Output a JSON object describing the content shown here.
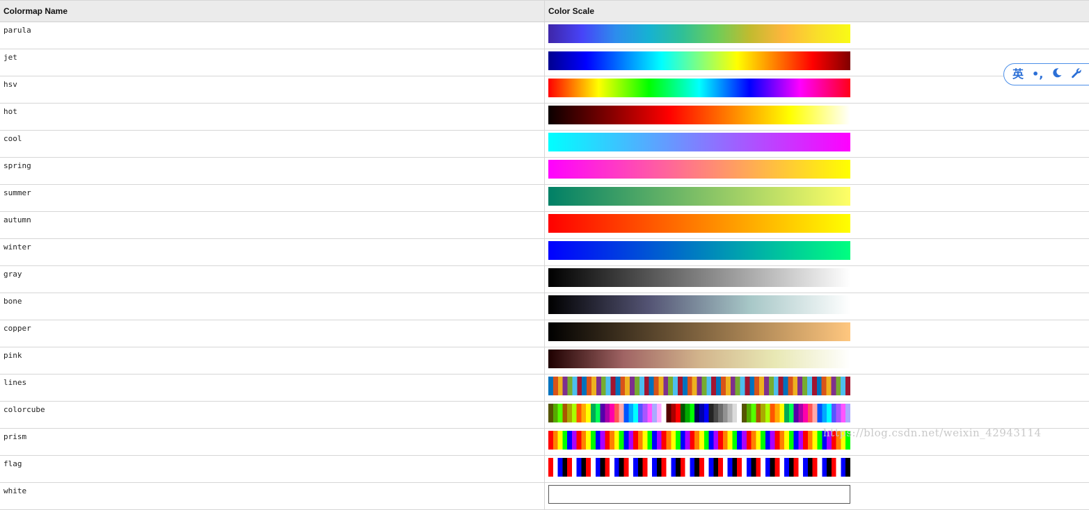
{
  "table": {
    "header": {
      "name_col": "Colormap Name",
      "scale_col": "Color Scale"
    },
    "rows": [
      {
        "name": "parula",
        "style": "gradient",
        "colors": [
          "#3e26a8",
          "#4743f8",
          "#2d8ced",
          "#16b2d2",
          "#30c096",
          "#6ccd5a",
          "#c1bb2f",
          "#feb63c",
          "#f9de2a",
          "#f9fb15"
        ]
      },
      {
        "name": "jet",
        "style": "gradient",
        "colors": [
          "#00008f",
          "#0000ff",
          "#0080ff",
          "#00ffff",
          "#80ff80",
          "#ffff00",
          "#ff8000",
          "#ff0000",
          "#800000"
        ]
      },
      {
        "name": "hsv",
        "style": "gradient",
        "colors": [
          "#ff0000",
          "#ffff00",
          "#00ff00",
          "#00ffff",
          "#0000ff",
          "#ff00ff",
          "#ff0018"
        ]
      },
      {
        "name": "hot",
        "style": "gradient",
        "colors": [
          "#0b0000",
          "#800000",
          "#ff0000",
          "#ff8000",
          "#ffff00",
          "#ffffff"
        ]
      },
      {
        "name": "cool",
        "style": "gradient",
        "colors": [
          "#00ffff",
          "#ff00ff"
        ]
      },
      {
        "name": "spring",
        "style": "gradient",
        "colors": [
          "#ff00ff",
          "#ffff00"
        ]
      },
      {
        "name": "summer",
        "style": "gradient",
        "colors": [
          "#008066",
          "#ffff66"
        ]
      },
      {
        "name": "autumn",
        "style": "gradient",
        "colors": [
          "#ff0000",
          "#ffff00"
        ]
      },
      {
        "name": "winter",
        "style": "gradient",
        "colors": [
          "#0000ff",
          "#00ff80"
        ]
      },
      {
        "name": "gray",
        "style": "gradient",
        "colors": [
          "#000000",
          "#ffffff"
        ]
      },
      {
        "name": "bone",
        "style": "gradient",
        "colors": [
          "#000000",
          "#545474",
          "#a7c7c7",
          "#ffffff"
        ]
      },
      {
        "name": "copper",
        "style": "gradient",
        "colors": [
          "#000000",
          "#ffc77f"
        ]
      },
      {
        "name": "pink",
        "style": "gradient",
        "colors": [
          "#1e0000",
          "#a06464",
          "#d2b48c",
          "#e8e8b4",
          "#ffffff"
        ]
      },
      {
        "name": "lines",
        "style": "blocks",
        "colors": [
          "#0072bd",
          "#d95319",
          "#edb120",
          "#7e2f8e",
          "#77ac30",
          "#4dbeee",
          "#a2142f"
        ],
        "count": 63
      },
      {
        "name": "colorcube",
        "style": "blocks",
        "colors": [
          "#555500",
          "#55aa00",
          "#55ff00",
          "#aa5500",
          "#aaaa00",
          "#aaff00",
          "#ff5500",
          "#ffaa00",
          "#ffff00",
          "#00aa55",
          "#00ff55",
          "#5500aa",
          "#aa00aa",
          "#ff00aa",
          "#ff5555",
          "#ffaaaa",
          "#0055ff",
          "#00aaff",
          "#00ffff",
          "#5555ff",
          "#aa55ff",
          "#ff55ff",
          "#aaaaff",
          "#ffaaff",
          "#ffffff",
          "#550000",
          "#aa0000",
          "#ff0000",
          "#005500",
          "#00aa00",
          "#00ff00",
          "#000055",
          "#0000aa",
          "#0000ff",
          "#242424",
          "#494949",
          "#6d6d6d",
          "#929292",
          "#b6b6b6",
          "#dbdbdb",
          "#ffffff"
        ],
        "count": 64
      },
      {
        "name": "prism",
        "style": "blocks",
        "colors": [
          "#ff0000",
          "#ff8000",
          "#ffff00",
          "#00ff00",
          "#0000ff",
          "#aa00ff"
        ],
        "count": 64
      },
      {
        "name": "flag",
        "style": "blocks",
        "colors": [
          "#ff0000",
          "#ffffff",
          "#0000ff",
          "#000000"
        ],
        "count": 64
      },
      {
        "name": "white",
        "style": "outline",
        "colors": [
          "#ffffff"
        ]
      }
    ]
  },
  "ime_toolbar": {
    "lang_label": "英",
    "punct_label": "•,",
    "icons": [
      "punctuation-icon",
      "moon-icon",
      "wrench-icon"
    ],
    "accent": "#2b6fd6"
  },
  "watermark": "https://blog.csdn.net/weixin_42943114"
}
